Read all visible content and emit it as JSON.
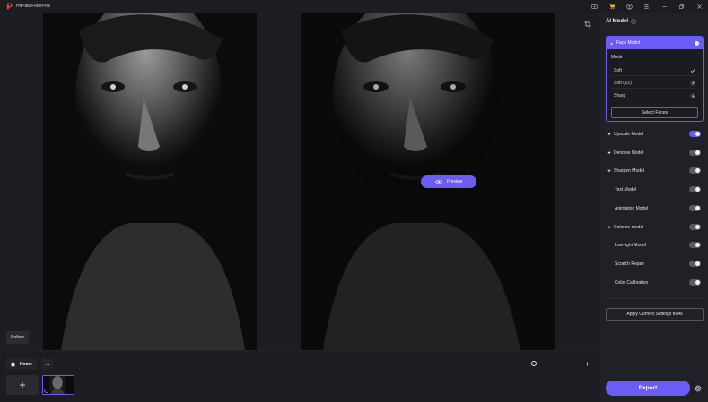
{
  "app": {
    "title": "HitPaw FotorPea",
    "icons": [
      "screen-record-icon",
      "cart-icon",
      "account-icon",
      "menu-icon",
      "minimize-icon",
      "restore-icon",
      "close-icon"
    ],
    "accent": "#6b5cf6"
  },
  "canvas": {
    "before_label": "Before",
    "preview_label": "Preview"
  },
  "bottom": {
    "home_label": "Home",
    "add_symbol": "+",
    "zoom_level": 0.0
  },
  "panel": {
    "title": "AI Model",
    "face_model": {
      "label": "Face Model",
      "enabled": true,
      "mode_label": "Mode",
      "modes": [
        {
          "label": "Soft",
          "state": "selected"
        },
        {
          "label": "Soft (V2)",
          "state": "download"
        },
        {
          "label": "Sharp",
          "state": "download"
        }
      ],
      "select_faces_label": "Select Faces"
    },
    "models": [
      {
        "label": "Upscale Model",
        "expandable": true,
        "enabled": true
      },
      {
        "label": "Denoise Model",
        "expandable": true,
        "enabled": false
      },
      {
        "label": "Sharpen Model",
        "expandable": true,
        "enabled": false
      },
      {
        "label": "Text Model",
        "expandable": false,
        "enabled": false
      },
      {
        "label": "Animation Model",
        "expandable": false,
        "enabled": false
      },
      {
        "label": "Colorize model",
        "expandable": true,
        "enabled": false
      },
      {
        "label": "Low-light Model",
        "expandable": false,
        "enabled": false
      },
      {
        "label": "Scratch Repair",
        "expandable": false,
        "enabled": false
      },
      {
        "label": "Color Calibration",
        "expandable": false,
        "enabled": false
      }
    ],
    "apply_all_label": "Apply Current Settings to All",
    "export_label": "Export"
  }
}
